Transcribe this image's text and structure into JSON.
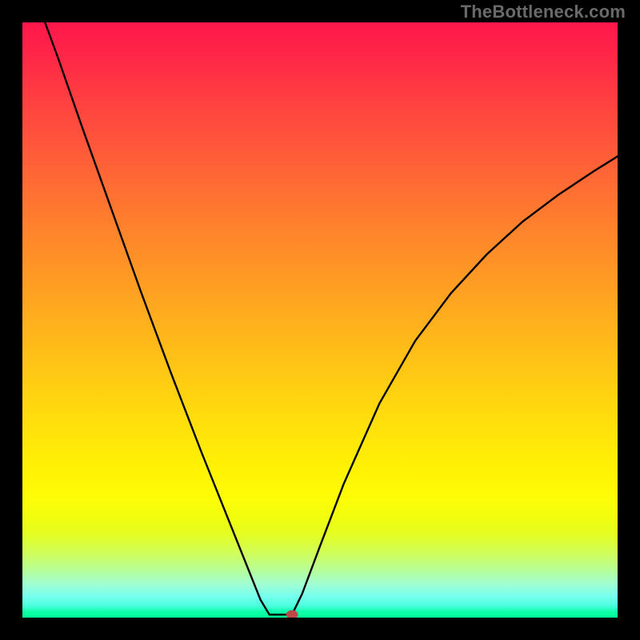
{
  "watermark": "TheBottleneck.com",
  "chart_data": {
    "type": "line",
    "title": "",
    "xlabel": "",
    "ylabel": "",
    "xlim": [
      0,
      100
    ],
    "ylim": [
      0,
      100
    ],
    "background_gradient": {
      "direction": "vertical",
      "top_color": "#ff164b",
      "bottom_color": "#00ff96",
      "stops": [
        {
          "pos": 0.0,
          "color": "#ff164b"
        },
        {
          "pos": 0.5,
          "color": "#ffba19"
        },
        {
          "pos": 0.8,
          "color": "#fdfd07"
        },
        {
          "pos": 1.0,
          "color": "#00ff96"
        }
      ]
    },
    "series": [
      {
        "name": "left-branch",
        "x": [
          3.8,
          6,
          10,
          15,
          20,
          25,
          30,
          35,
          38,
          40,
          41.5
        ],
        "y": [
          100,
          94,
          82.5,
          68.5,
          54.5,
          41,
          28,
          15.5,
          8,
          3,
          0.5
        ]
      },
      {
        "name": "flat-segment",
        "x": [
          41.5,
          45.3
        ],
        "y": [
          0.5,
          0.5
        ]
      },
      {
        "name": "right-branch",
        "x": [
          45.3,
          47,
          50,
          54,
          60,
          66,
          72,
          78,
          84,
          90,
          96,
          100
        ],
        "y": [
          0.5,
          4,
          12,
          22.5,
          36,
          46.5,
          54.5,
          61,
          66.5,
          71,
          75,
          77.5
        ]
      }
    ],
    "marker": {
      "x": 45.3,
      "y": 0.5,
      "color": "#b94a48"
    }
  }
}
